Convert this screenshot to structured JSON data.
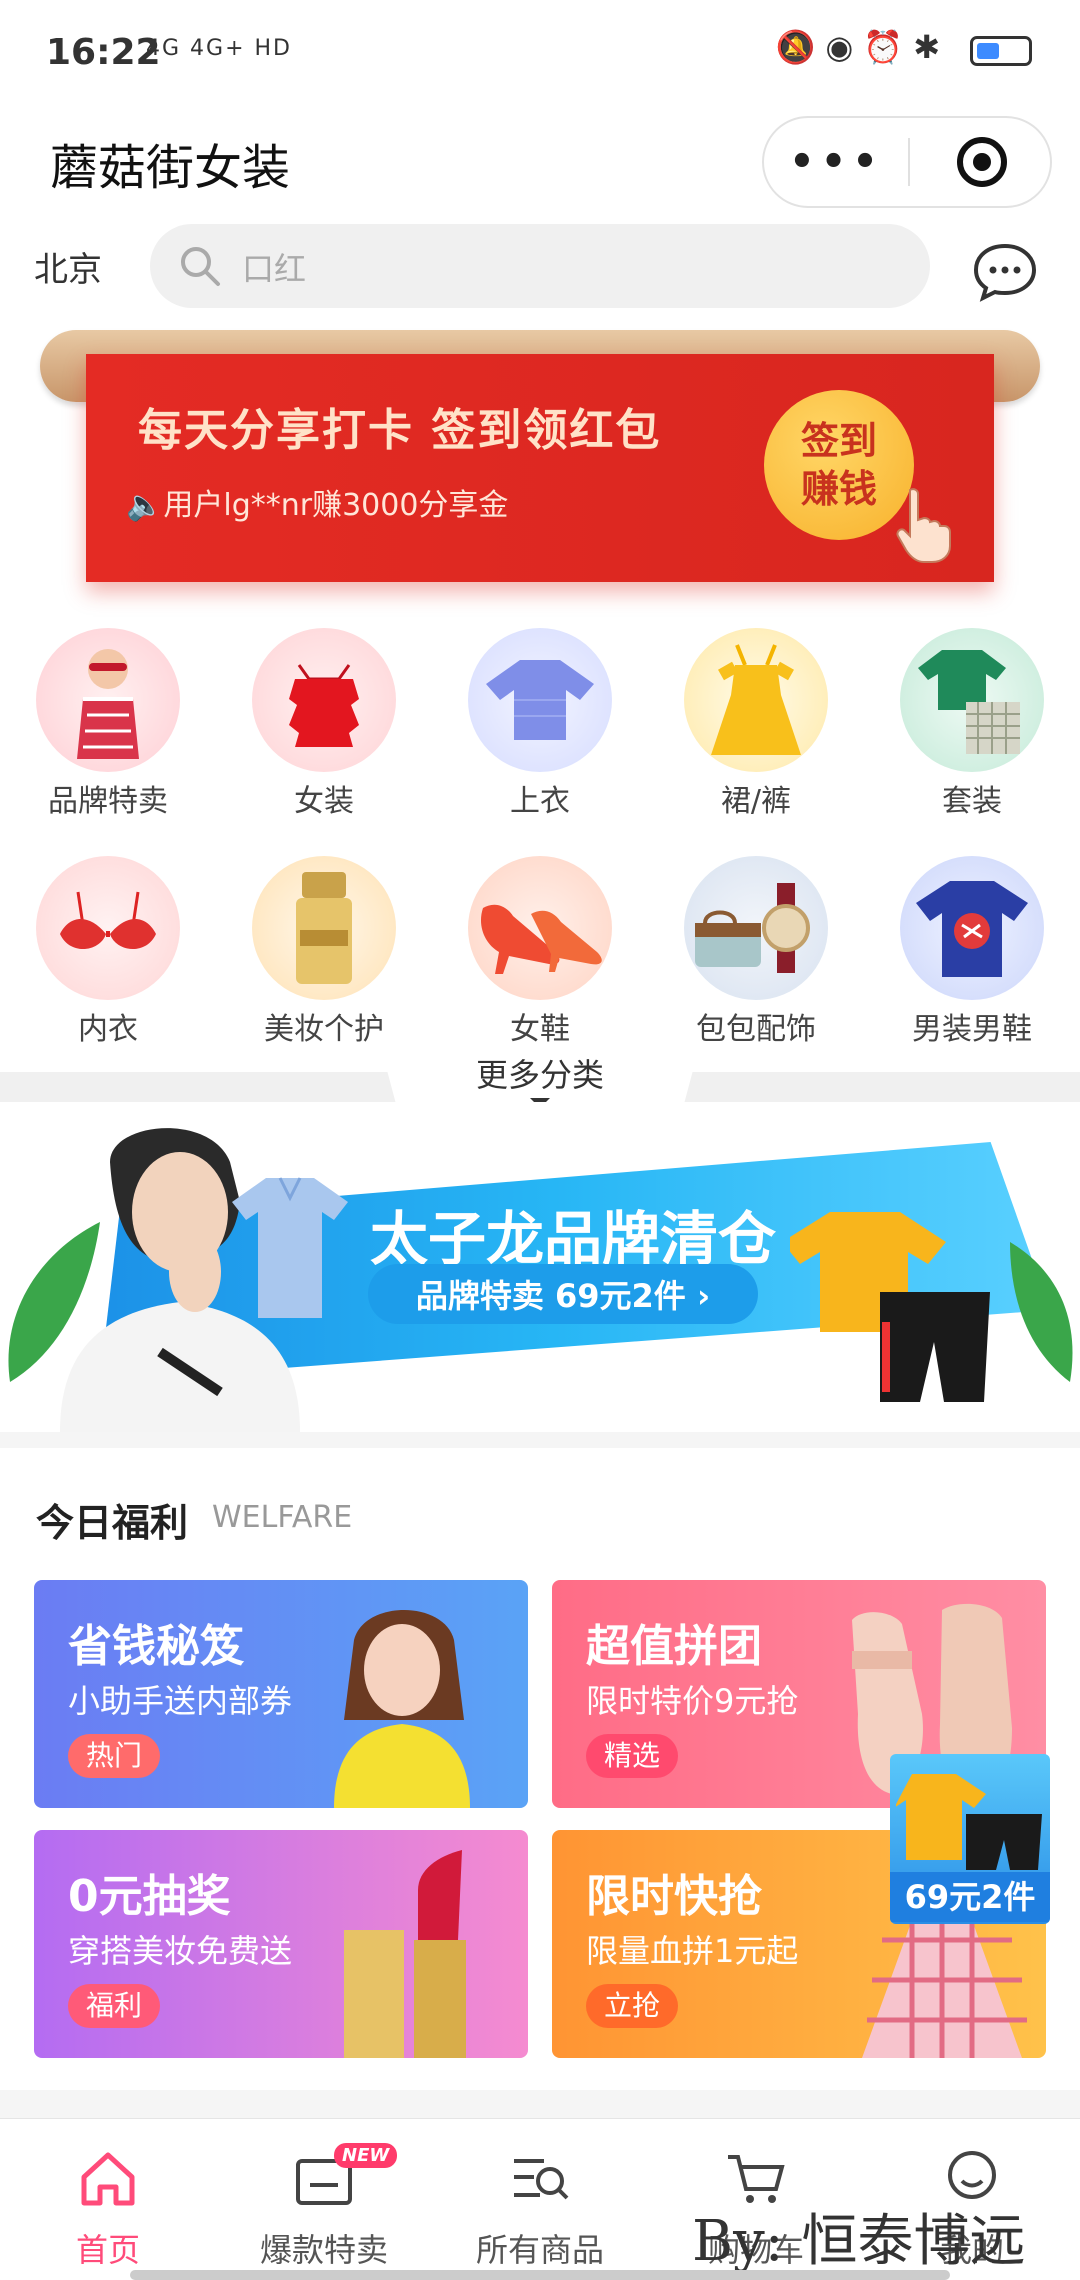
{
  "status_bar": {
    "time": "16:22",
    "network": "4G 4G+ HD"
  },
  "header": {
    "title": "蘑菇街女装"
  },
  "search": {
    "city": "北京",
    "placeholder": "口红"
  },
  "promo": {
    "title": "每天分享打卡  签到领红包",
    "ticker": "用户lg**nr赚3000分享金",
    "button_line1": "签到",
    "button_line2": "赚钱"
  },
  "categories": [
    {
      "label": "品牌特卖"
    },
    {
      "label": "女装"
    },
    {
      "label": "上衣"
    },
    {
      "label": "裙/裤"
    },
    {
      "label": "套装"
    },
    {
      "label": "内衣"
    },
    {
      "label": "美妆个护"
    },
    {
      "label": "女鞋"
    },
    {
      "label": "包包配饰"
    },
    {
      "label": "男装男鞋"
    }
  ],
  "more_categories": "更多分类",
  "brand_banner": {
    "title": "太子龙品牌清仓",
    "pill": "品牌特卖 69元2件 ›"
  },
  "welfare": {
    "title": "今日福利",
    "title_en": "WELFARE",
    "cards": [
      {
        "title": "省钱秘笈",
        "subtitle": "小助手送内部券",
        "tag": "热门"
      },
      {
        "title": "超值拼团",
        "subtitle": "限时特价9元抢",
        "tag": "精选"
      },
      {
        "title": "0元抽奖",
        "subtitle": "穿搭美妆免费送",
        "tag": "福利"
      },
      {
        "title": "限时快抢",
        "subtitle": "限量血拼1元起",
        "tag": "立抢",
        "badge": "69元2件"
      }
    ]
  },
  "tabbar": {
    "items": [
      {
        "label": "首页",
        "icon": "home-icon",
        "active": true
      },
      {
        "label": "爆款特卖",
        "icon": "hot-sale-icon",
        "badge": "NEW"
      },
      {
        "label": "所有商品",
        "icon": "search-list-icon"
      },
      {
        "label": "购物车",
        "icon": "cart-icon"
      },
      {
        "label": "我的",
        "icon": "profile-icon"
      }
    ]
  },
  "watermark": "By: 恒泰博远",
  "colors": {
    "accent": "#ff4b7a",
    "promo_red": "#e42b24",
    "brand_blue": "#1b8ee6"
  }
}
